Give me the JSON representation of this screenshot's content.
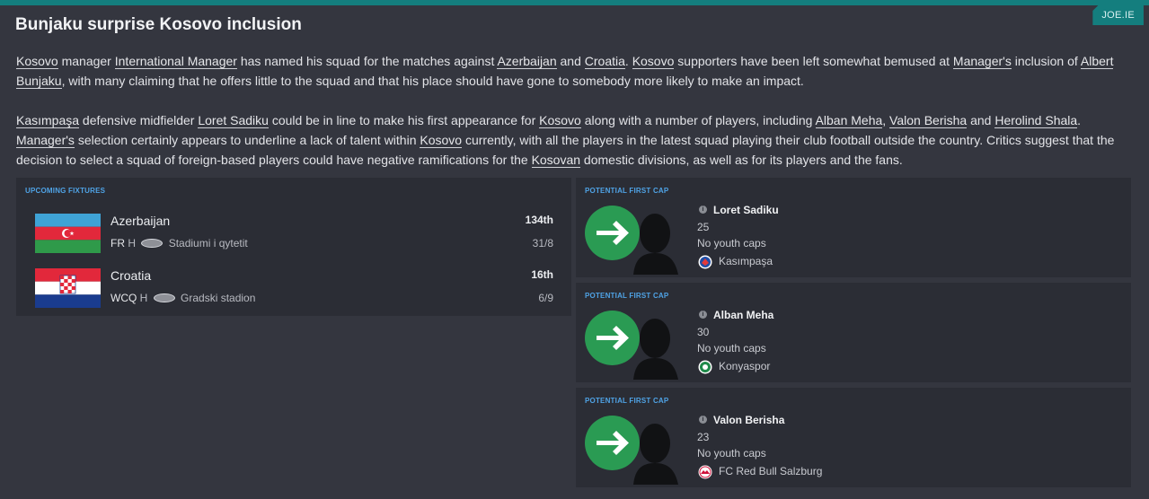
{
  "source_tag": "JOE.IE",
  "headline": "Bunjaku surprise Kosovo inclusion",
  "article": {
    "p1": [
      {
        "t": "Kosovo",
        "link": true
      },
      {
        "t": " manager "
      },
      {
        "t": "International Manager",
        "link": true
      },
      {
        "t": " has named his squad for the matches against "
      },
      {
        "t": "Azerbaijan",
        "link": true
      },
      {
        "t": " and "
      },
      {
        "t": "Croatia",
        "link": true
      },
      {
        "t": ". "
      },
      {
        "t": "Kosovo",
        "link": true
      },
      {
        "t": " supporters have been left somewhat bemused at "
      },
      {
        "t": "Manager's",
        "link": true
      },
      {
        "t": " inclusion of "
      },
      {
        "t": "Albert Bunjaku",
        "link": true
      },
      {
        "t": ", with many claiming that he offers little to the squad and that his place should have gone to somebody more likely to make an impact."
      }
    ],
    "p2": [
      {
        "t": "Kasımpaşa",
        "link": true
      },
      {
        "t": " defensive midfielder "
      },
      {
        "t": "Loret Sadiku",
        "link": true
      },
      {
        "t": " could be in line to make his first appearance for "
      },
      {
        "t": "Kosovo",
        "link": true
      },
      {
        "t": " along with a number of players, including "
      },
      {
        "t": "Alban Meha",
        "link": true
      },
      {
        "t": ", "
      },
      {
        "t": "Valon Berisha",
        "link": true
      },
      {
        "t": " and "
      },
      {
        "t": "Herolind Shala",
        "link": true
      },
      {
        "t": ". "
      },
      {
        "t": "Manager's",
        "link": true
      },
      {
        "t": " selection certainly appears to underline a lack of talent within "
      },
      {
        "t": "Kosovo",
        "link": true
      },
      {
        "t": " currently, with all the players in the latest squad playing their club football outside the country. Critics suggest that the decision to select a squad of foreign-based players could have negative ramifications for the "
      },
      {
        "t": "Kosovan",
        "link": true
      },
      {
        "t": " domestic divisions, as well as for its players and the fans."
      }
    ]
  },
  "fixtures": {
    "label": "UPCOMING FIXTURES",
    "items": [
      {
        "team": "Azerbaijan",
        "comp": "FR",
        "venue_type": "H",
        "stadium": "Stadiumi i qytetit",
        "rank": "134th",
        "date": "31/8"
      },
      {
        "team": "Croatia",
        "comp": "WCQ",
        "venue_type": "H",
        "stadium": "Gradski stadion",
        "rank": "16th",
        "date": "6/9"
      }
    ]
  },
  "first_caps": [
    {
      "label": "POTENTIAL FIRST CAP",
      "name": "Loret Sadiku",
      "age": "25",
      "caps": "No youth caps",
      "club": "Kasımpaşa",
      "club_colors": [
        "#1f4fa8",
        "#e23a3a"
      ]
    },
    {
      "label": "POTENTIAL FIRST CAP",
      "name": "Alban Meha",
      "age": "30",
      "caps": "No youth caps",
      "club": "Konyaspor",
      "club_colors": [
        "#1f8a4a",
        "#ffffff"
      ]
    },
    {
      "label": "POTENTIAL FIRST CAP",
      "name": "Valon Berisha",
      "age": "23",
      "caps": "No youth caps",
      "club": "FC Red Bull Salzburg",
      "club_colors": [
        "#d0103a",
        "#ffffff"
      ]
    }
  ],
  "colors": {
    "accent": "#147e7e",
    "link_blue": "#4fa3e6",
    "arrow_green": "#2a9b53",
    "panel": "#2b2d35",
    "background": "#34363f"
  },
  "icons": [
    "info-icon",
    "stadium-icon",
    "arrow-right-icon",
    "player-silhouette",
    "club-badge"
  ]
}
